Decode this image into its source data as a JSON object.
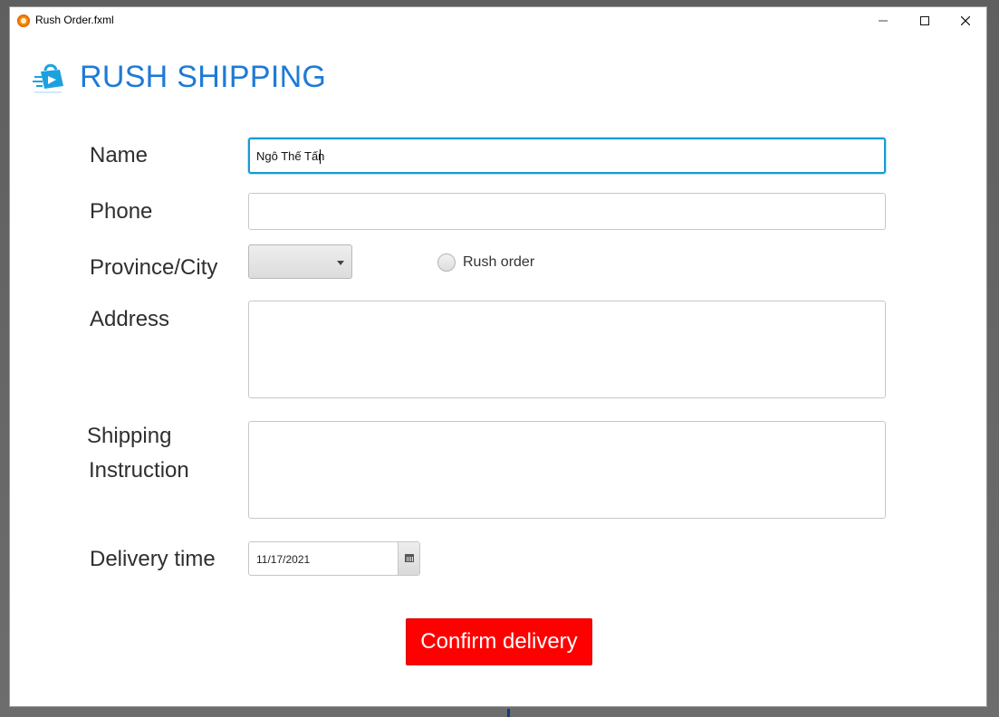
{
  "window": {
    "title": "Rush Order.fxml"
  },
  "app": {
    "title": "RUSH SHIPPING",
    "brand_color": "#1f7ad6",
    "logo_icon": "shopping-bag-logo-icon"
  },
  "form": {
    "name_label": "Name",
    "name_value": "Ngô Thế Tấn",
    "phone_label": "Phone",
    "phone_value": "",
    "province_label": "Province/City",
    "province_value": "",
    "rush_order_label": "Rush order",
    "address_label": "Address",
    "address_value": "",
    "shipping_label_line1": "Shipping",
    "shipping_label_line2": "Instruction",
    "shipping_instruction_value": "",
    "delivery_time_label": "Delivery time",
    "delivery_date": "11/17/2021",
    "confirm_label": "Confirm delivery",
    "confirm_color": "#ff0000",
    "focus_color": "#169ad3"
  }
}
